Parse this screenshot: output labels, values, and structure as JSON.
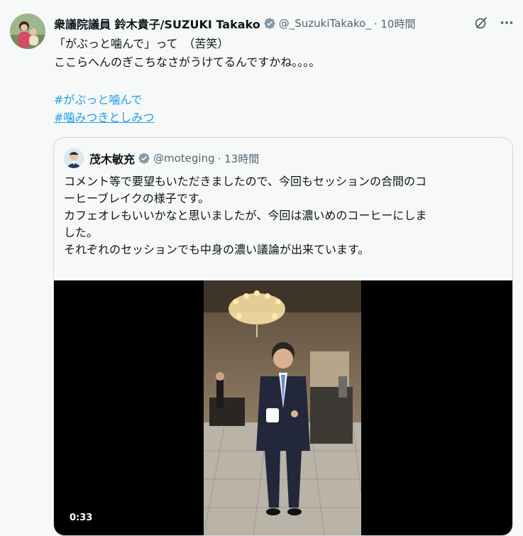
{
  "author": {
    "name": "衆議院議員 鈴木貴子/SUZUKI Takako",
    "handle": "@_SuzukiTakako_",
    "time": "· 10時間"
  },
  "tweet": {
    "line1": "「がぶっと噛んで」って　（苦笑）",
    "line2": "ここらへんのぎこちなさがうけてるんですかね。。。。",
    "hashtags": [
      "#がぶっと噛んで",
      "#噛みつきとしみつ"
    ]
  },
  "quote": {
    "name": "茂木敏充",
    "handle": "@moteging",
    "time": "· 13時間",
    "lines": [
      "コメント等で要望もいただきましたので、今回もセッションの合間のコ",
      "ーヒーブレイクの様子です。",
      "カフェオレもいいかなと思いましたが、今回は濃いめのコーヒーにしま",
      "した。",
      "それぞれのセッションでも中身の濃い議論が出来ています。"
    ]
  },
  "video": {
    "duration": "0:33"
  },
  "icons": {
    "verified": "verified-badge-icon",
    "grok": "grok-icon",
    "more": "more-icon"
  },
  "colors": {
    "link": "#1d9bf0",
    "secondary": "#536471",
    "verified": "#829aab"
  }
}
